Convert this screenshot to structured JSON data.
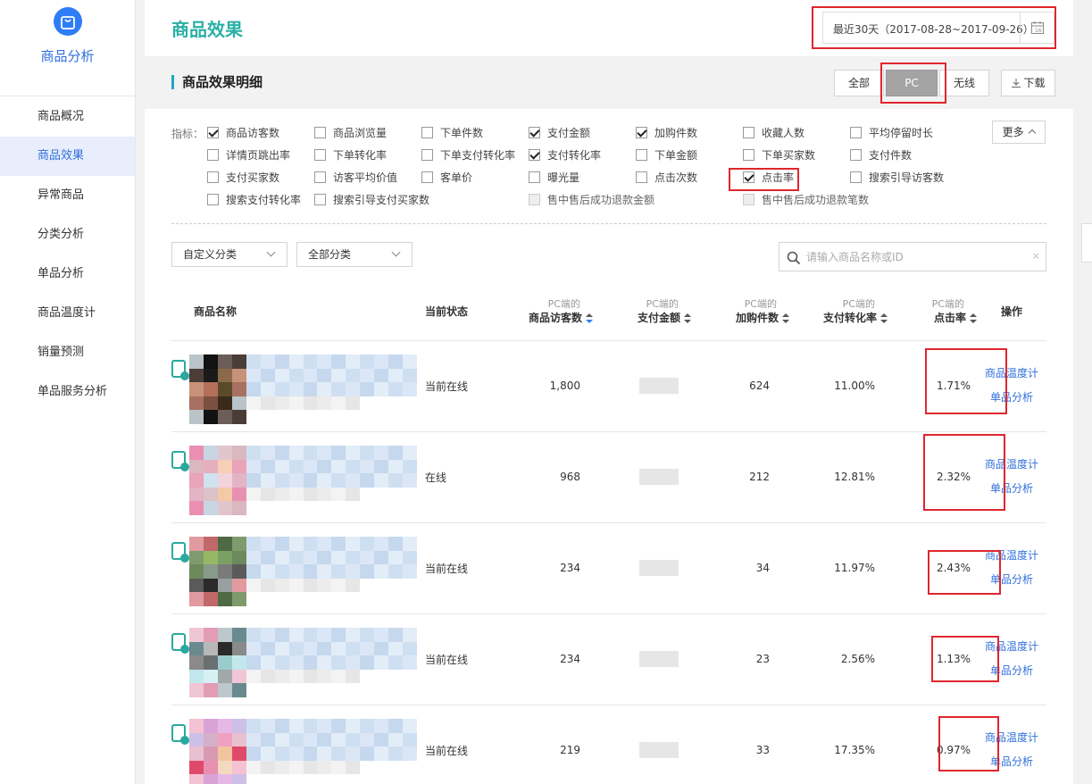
{
  "sidebar": {
    "brand": "商品分析",
    "items": [
      {
        "label": "商品概况",
        "active": false
      },
      {
        "label": "商品效果",
        "active": true
      },
      {
        "label": "异常商品",
        "active": false
      },
      {
        "label": "分类分析",
        "active": false
      },
      {
        "label": "单品分析",
        "active": false
      },
      {
        "label": "商品温度计",
        "active": false
      },
      {
        "label": "销量预测",
        "active": false
      },
      {
        "label": "单品服务分析",
        "active": false
      }
    ]
  },
  "header": {
    "title": "商品效果",
    "date_range": "最近30天（2017-08-28~2017-09-26）"
  },
  "panel": {
    "title": "商品效果明细",
    "segments": [
      "全部",
      "PC",
      "无线"
    ],
    "active_segment": "PC",
    "download": "下载",
    "more": "更多"
  },
  "metrics": {
    "label": "指标：",
    "rows": [
      [
        {
          "label": "商品访客数",
          "checked": true
        },
        {
          "label": "商品浏览量",
          "checked": false
        },
        {
          "label": "下单件数",
          "checked": false
        },
        {
          "label": "支付金额",
          "checked": true
        },
        {
          "label": "加购件数",
          "checked": true
        },
        {
          "label": "收藏人数",
          "checked": false
        },
        {
          "label": "平均停留时长",
          "checked": false
        }
      ],
      [
        {
          "label": "详情页跳出率",
          "checked": false
        },
        {
          "label": "下单转化率",
          "checked": false
        },
        {
          "label": "下单支付转化率",
          "checked": false
        },
        {
          "label": "支付转化率",
          "checked": true
        },
        {
          "label": "下单金额",
          "checked": false
        },
        {
          "label": "下单买家数",
          "checked": false
        },
        {
          "label": "支付件数",
          "checked": false
        }
      ],
      [
        {
          "label": "支付买家数",
          "checked": false
        },
        {
          "label": "访客平均价值",
          "checked": false
        },
        {
          "label": "客单价",
          "checked": false
        },
        {
          "label": "曝光量",
          "checked": false
        },
        {
          "label": "点击次数",
          "checked": false
        },
        {
          "label": "点击率",
          "checked": true
        },
        {
          "label": "搜索引导访客数",
          "checked": false
        }
      ],
      [
        {
          "label": "搜索支付转化率",
          "checked": false
        },
        {
          "label": "搜索引导支付买家数",
          "checked": false
        },
        {
          "label": "",
          "checked": false
        },
        {
          "label": "售中售后成功退款金额",
          "checked": false,
          "disabled": true
        },
        {
          "label": "",
          "checked": false
        },
        {
          "label": "售中售后成功退款笔数",
          "checked": false,
          "disabled": true
        },
        {
          "label": "",
          "checked": false
        }
      ]
    ]
  },
  "filters": {
    "custom_category": "自定义分类",
    "all_category": "全部分类",
    "search_placeholder": "请输入商品名称或ID"
  },
  "table": {
    "headers": {
      "name": "商品名称",
      "status": "当前状态",
      "visitors_sub": "PC端的",
      "visitors": "商品访客数",
      "pay_sub": "PC端的",
      "pay": "支付金额",
      "cart_sub": "PC端的",
      "cart": "加购件数",
      "conv_sub": "PC端的",
      "conv": "支付转化率",
      "ctr_sub": "PC端的",
      "ctr": "点击率",
      "ops": "操作"
    },
    "rows": [
      {
        "status": "当前在线",
        "visitors": "1,800",
        "cart": "624",
        "conv": "11.00%",
        "ctr": "1.71%",
        "op1": "商品温度计",
        "op2": "单品分析"
      },
      {
        "status": "在线",
        "visitors": "968",
        "cart": "212",
        "conv": "12.81%",
        "ctr": "2.32%",
        "op1": "商品温度计",
        "op2": "单品分析"
      },
      {
        "status": "当前在线",
        "visitors": "234",
        "cart": "34",
        "conv": "11.97%",
        "ctr": "2.43%",
        "op1": "商品温度计",
        "op2": "单品分析"
      },
      {
        "status": "当前在线",
        "visitors": "234",
        "cart": "23",
        "conv": "2.56%",
        "ctr": "1.13%",
        "op1": "商品温度计",
        "op2": "单品分析"
      },
      {
        "status": "当前在线",
        "visitors": "219",
        "cart": "33",
        "conv": "17.35%",
        "ctr": "0.97%",
        "op1": "商品温度计",
        "op2": "单品分析"
      }
    ]
  },
  "colors": {
    "accent": "#2bb0a7",
    "link": "#2f6fdc",
    "highlight": "#e0262e"
  }
}
